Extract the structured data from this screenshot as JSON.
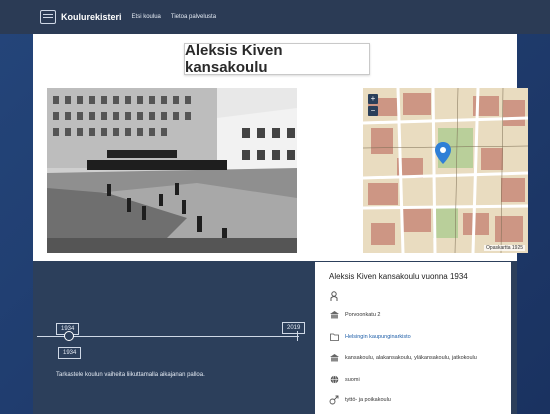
{
  "nav": {
    "brand": "Koulurekisteri",
    "links": [
      "Etsi koulua",
      "Tietoa palvelusta"
    ]
  },
  "page": {
    "title": "Aleksis Kiven kansakoulu"
  },
  "map": {
    "zoom_in": "+",
    "zoom_out": "−",
    "credit": "Opaskartta 1925"
  },
  "timeline": {
    "start_year": "1934",
    "end_year": "2019",
    "selected_year": "1934",
    "hint": "Tarkastele koulun vaiheita liikuttamalla aikajanan palloa."
  },
  "info": {
    "title": "Aleksis Kiven kansakoulu vuonna 1934",
    "items": [
      {
        "icon": "person-icon",
        "text": ""
      },
      {
        "icon": "building-icon",
        "text": "Porvoonkatu 2"
      },
      {
        "icon": "folder-icon",
        "text": "Helsingin kaupunginarkisto"
      },
      {
        "icon": "school-type-icon",
        "text": "kansakoulu, alakansakoulu, yläkansakoulu, jatkokoulu"
      },
      {
        "icon": "language-icon",
        "text": "suomi"
      },
      {
        "icon": "gender-icon",
        "text": "tyttö- ja poikakoulu"
      }
    ]
  },
  "colors": {
    "navbar": "#2b3b55",
    "panel": "#2c3f5b",
    "link": "#1f5fa8"
  }
}
